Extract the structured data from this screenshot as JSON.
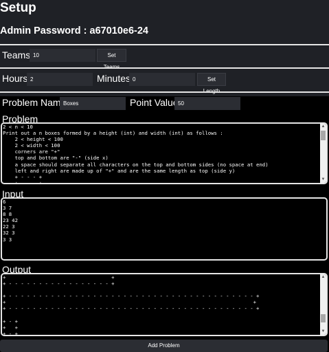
{
  "header": {
    "title": "Setup",
    "admin_password_text": "Admin Password : a67010e6-24"
  },
  "teams": {
    "label": "Teams",
    "value": "10",
    "button": "Set Teams"
  },
  "length": {
    "hours_label": "Hours",
    "hours_value": "2",
    "minutes_label": "Minutes",
    "minutes_value": "0",
    "button": "Set Length"
  },
  "problem_meta": {
    "name_label": "Problem Name",
    "name_value": "Boxes",
    "point_label": "Point Value",
    "point_value": "50"
  },
  "problem": {
    "label": "Problem",
    "text": "2 < n < 10\nPrint out a n boxes formed by a height (int) and width (int) as follows :\n    2 < height < 100\n    2 < width < 100\n    corners are \"+\"\n    top and bottom are \"-\" (side x)\n    a space should separate all characters on the top and bottom sides (no space at end)\n    left and right are made up of \"+\" and are the same length as top (side y)\n    + - - - +\n    +       +"
  },
  "input": {
    "label": "Input",
    "text": "6\n3 7\n8 8\n23 42\n22 3\n32 3\n3 3"
  },
  "output": {
    "label": "Output",
    "text": "+                                   +\n+ - - - - - - - - - - - - - - - - - +\n\n+ - - - - - - - - - - - - - - - - - - - - - - - - - - - - - - - - - - - - - - - - - +\n+                                                                                  +\n+ - - - - - - - - - - - - - - - - - - - - - - - - - - - - - - - - - - - - - - - - - +\n\n+ - +\n+   +\n+ - +"
  },
  "add_button": "Add Problem"
}
